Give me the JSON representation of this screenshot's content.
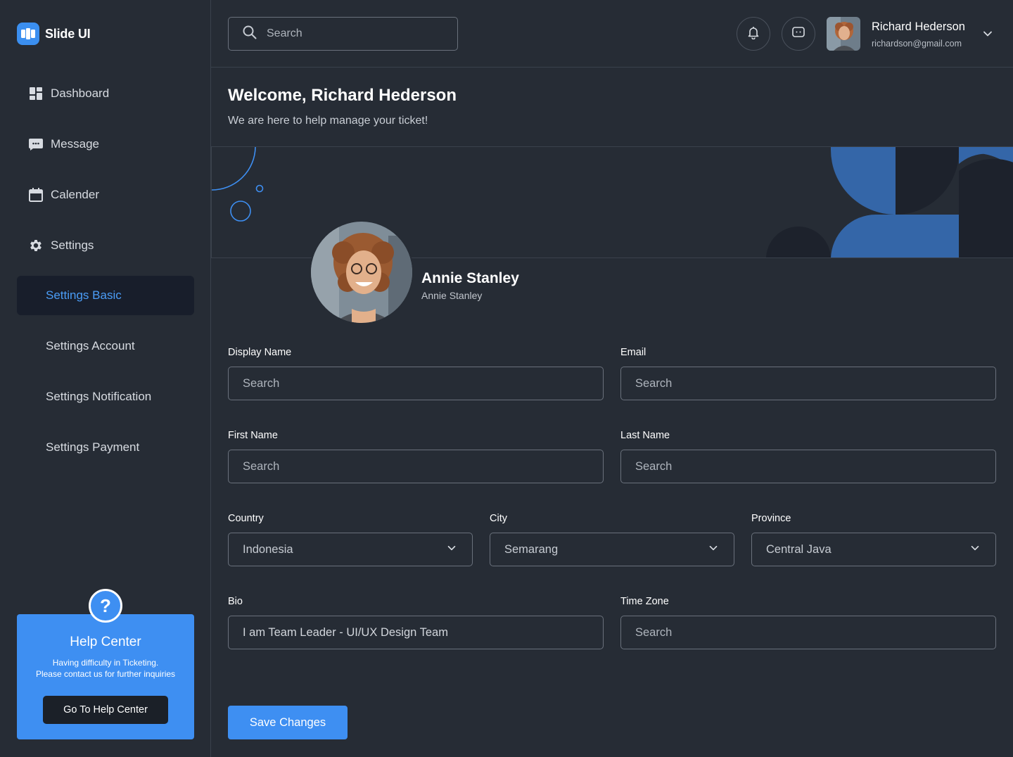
{
  "app": {
    "name": "Slide UI",
    "brand_color": "#3b8ff0"
  },
  "sidebar": {
    "nav": [
      {
        "label": "Dashboard",
        "icon": "dashboard-icon"
      },
      {
        "label": "Message",
        "icon": "message-icon"
      },
      {
        "label": "Calender",
        "icon": "calendar-icon"
      },
      {
        "label": "Settings",
        "icon": "gear-icon"
      }
    ],
    "settings_sub": [
      {
        "label": "Settings Basic",
        "active": true
      },
      {
        "label": "Settings Account",
        "active": false
      },
      {
        "label": "Settings Notification",
        "active": false
      },
      {
        "label": "Settings Payment",
        "active": false
      }
    ],
    "help": {
      "badge": "?",
      "title": "Help Center",
      "desc_line1": "Having difficulty in Ticketing.",
      "desc_line2": "Please contact us for further inquiries",
      "button": "Go To Help Center"
    }
  },
  "header": {
    "search_placeholder": "Search",
    "user": {
      "name": "Richard Hederson",
      "email": "richardson@gmail.com"
    }
  },
  "welcome": {
    "title": "Welcome, Richard Hederson",
    "subtitle": "We are here to help manage your ticket!"
  },
  "profile": {
    "name": "Annie Stanley",
    "subtitle": "Annie Stanley"
  },
  "form": {
    "display_name": {
      "label": "Display Name",
      "placeholder": "Search"
    },
    "email": {
      "label": "Email",
      "placeholder": "Search"
    },
    "first_name": {
      "label": "First Name",
      "placeholder": "Search"
    },
    "last_name": {
      "label": "Last Name",
      "placeholder": "Search"
    },
    "country": {
      "label": "Country",
      "value": "Indonesia"
    },
    "city": {
      "label": "City",
      "value": "Semarang"
    },
    "province": {
      "label": "Province",
      "value": "Central Java"
    },
    "bio": {
      "label": "Bio",
      "value": "I am Team Leader - UI/UX Design Team"
    },
    "time_zone": {
      "label": "Time Zone",
      "placeholder": "Search"
    },
    "save_button": "Save Changes"
  }
}
